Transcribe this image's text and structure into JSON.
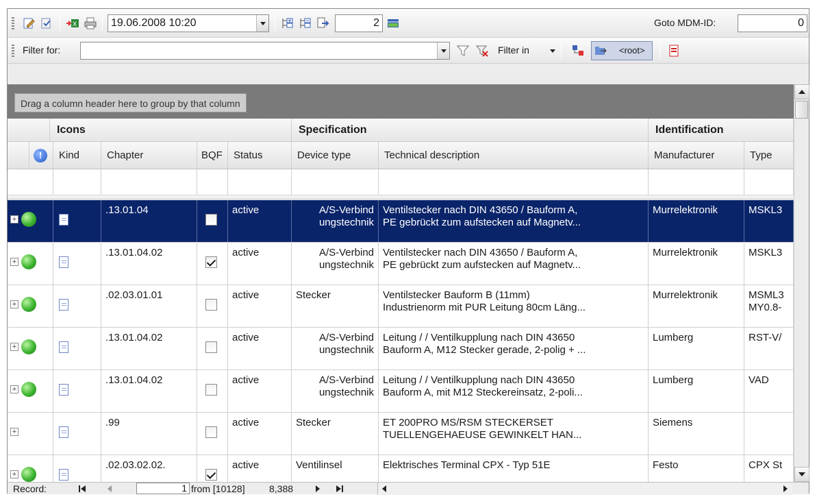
{
  "toolbar": {
    "datetime": "19.06.2008 10:20",
    "level": "2",
    "goto_label": "Goto MDM-ID:",
    "goto_value": "0"
  },
  "filterbar": {
    "filter_label": "Filter for:",
    "filter_value": "",
    "filter_in_label": "Filter in",
    "root_label": "<root>"
  },
  "group_panel": {
    "hint": "Drag a column header here to group by that column"
  },
  "bands": {
    "icons": "Icons",
    "specification": "Specification",
    "identification": "Identification"
  },
  "columns": {
    "kind": "Kind",
    "chapter": "Chapter",
    "bqf": "BQF",
    "status": "Status",
    "device_type": "Device type",
    "technical_description": "Technical description",
    "manufacturer": "Manufacturer",
    "type": "Type"
  },
  "rows": [
    {
      "chapter": ".13.01.04",
      "bqf": false,
      "status": "active",
      "device1": "A/S-Verbind",
      "device2": "ungstechnik",
      "desc1": "Ventilstecker nach DIN 43650 / Bauform A,",
      "desc2": "PE gebrückt zum aufstecken auf Magnetv...",
      "manufacturer": "Murrelektronik",
      "type1": "MSKL3",
      "type2": ""
    },
    {
      "chapter": ".13.01.04.02",
      "bqf": true,
      "status": "active",
      "device1": "A/S-Verbind",
      "device2": "ungstechnik",
      "desc1": "Ventilstecker nach DIN 43650 / Bauform A,",
      "desc2": "PE gebrückt zum aufstecken auf Magnetv...",
      "manufacturer": "Murrelektronik",
      "type1": "MSKL3",
      "type2": ""
    },
    {
      "chapter": ".02.03.01.01",
      "bqf": false,
      "status": "active",
      "device1": "Stecker",
      "device2": "",
      "desc1": "Ventilstecker Bauform B (11mm)",
      "desc2": "Industrienorm mit PUR Leitung 80cm Läng...",
      "manufacturer": "Murrelektronik",
      "type1": "MSML3",
      "type2": "MY0.8-"
    },
    {
      "chapter": ".13.01.04.02",
      "bqf": false,
      "status": "active",
      "device1": "A/S-Verbind",
      "device2": "ungstechnik",
      "desc1": "Leitung /  / Ventilkupplung nach DIN 43650",
      "desc2": "Bauform A, M12 Stecker gerade, 2-polig + ...",
      "manufacturer": "Lumberg",
      "type1": "RST-V/",
      "type2": ""
    },
    {
      "chapter": ".13.01.04.02",
      "bqf": false,
      "status": "active",
      "device1": "A/S-Verbind",
      "device2": "ungstechnik",
      "desc1": "Leitung /  / Ventilkupplung nach DIN 43650",
      "desc2": "Bauform A, mit M12 Steckereinsatz, 2-poli...",
      "manufacturer": "Lumberg",
      "type1": "VAD",
      "type2": ""
    },
    {
      "chapter": ".99",
      "bqf": false,
      "status": "active",
      "device1": "Stecker",
      "device2": "",
      "desc1": "ET 200PRO MS/RSM STECKERSET",
      "desc2": "TUELLENGEHAEUSE GEWINKELT HAN...",
      "manufacturer": "Siemens",
      "type1": "",
      "type2": ""
    },
    {
      "chapter": ".02.03.02.02.",
      "bqf": true,
      "status": "active",
      "device1": "Ventilinsel",
      "device2": "",
      "desc1": "Elektrisches Terminal CPX - Typ 51E",
      "desc2": "",
      "manufacturer": "Festo",
      "type1": "CPX St",
      "type2": ""
    }
  ],
  "navigator": {
    "record_label": "Record:",
    "current": "1",
    "from_text": "from [10128]",
    "count": "8,388"
  }
}
